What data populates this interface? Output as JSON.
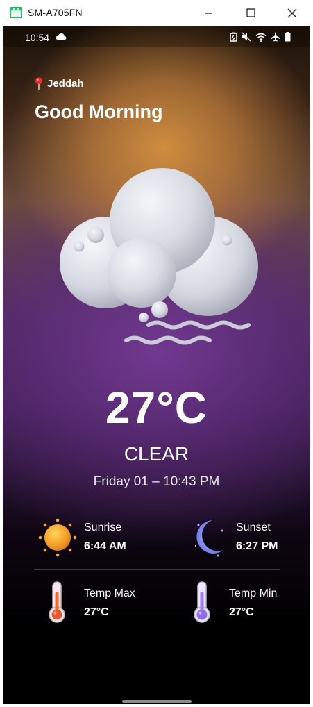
{
  "window": {
    "title": "SM-A705FN"
  },
  "status_bar": {
    "time": "10:54"
  },
  "location": {
    "city": "Jeddah"
  },
  "greeting": "Good Morning",
  "weather": {
    "temperature": "27°C",
    "condition": "CLEAR",
    "date_time": "Friday 01 – 10:43 PM"
  },
  "stats": {
    "sunrise": {
      "label": "Sunrise",
      "value": "6:44 AM"
    },
    "sunset": {
      "label": "Sunset",
      "value": "6:27 PM"
    },
    "temp_max": {
      "label": "Temp Max",
      "value": "27°C"
    },
    "temp_min": {
      "label": "Temp Min",
      "value": "27°C"
    }
  },
  "colors": {
    "accent_orange": "#d6913f",
    "accent_purple": "#6b3a8f"
  }
}
